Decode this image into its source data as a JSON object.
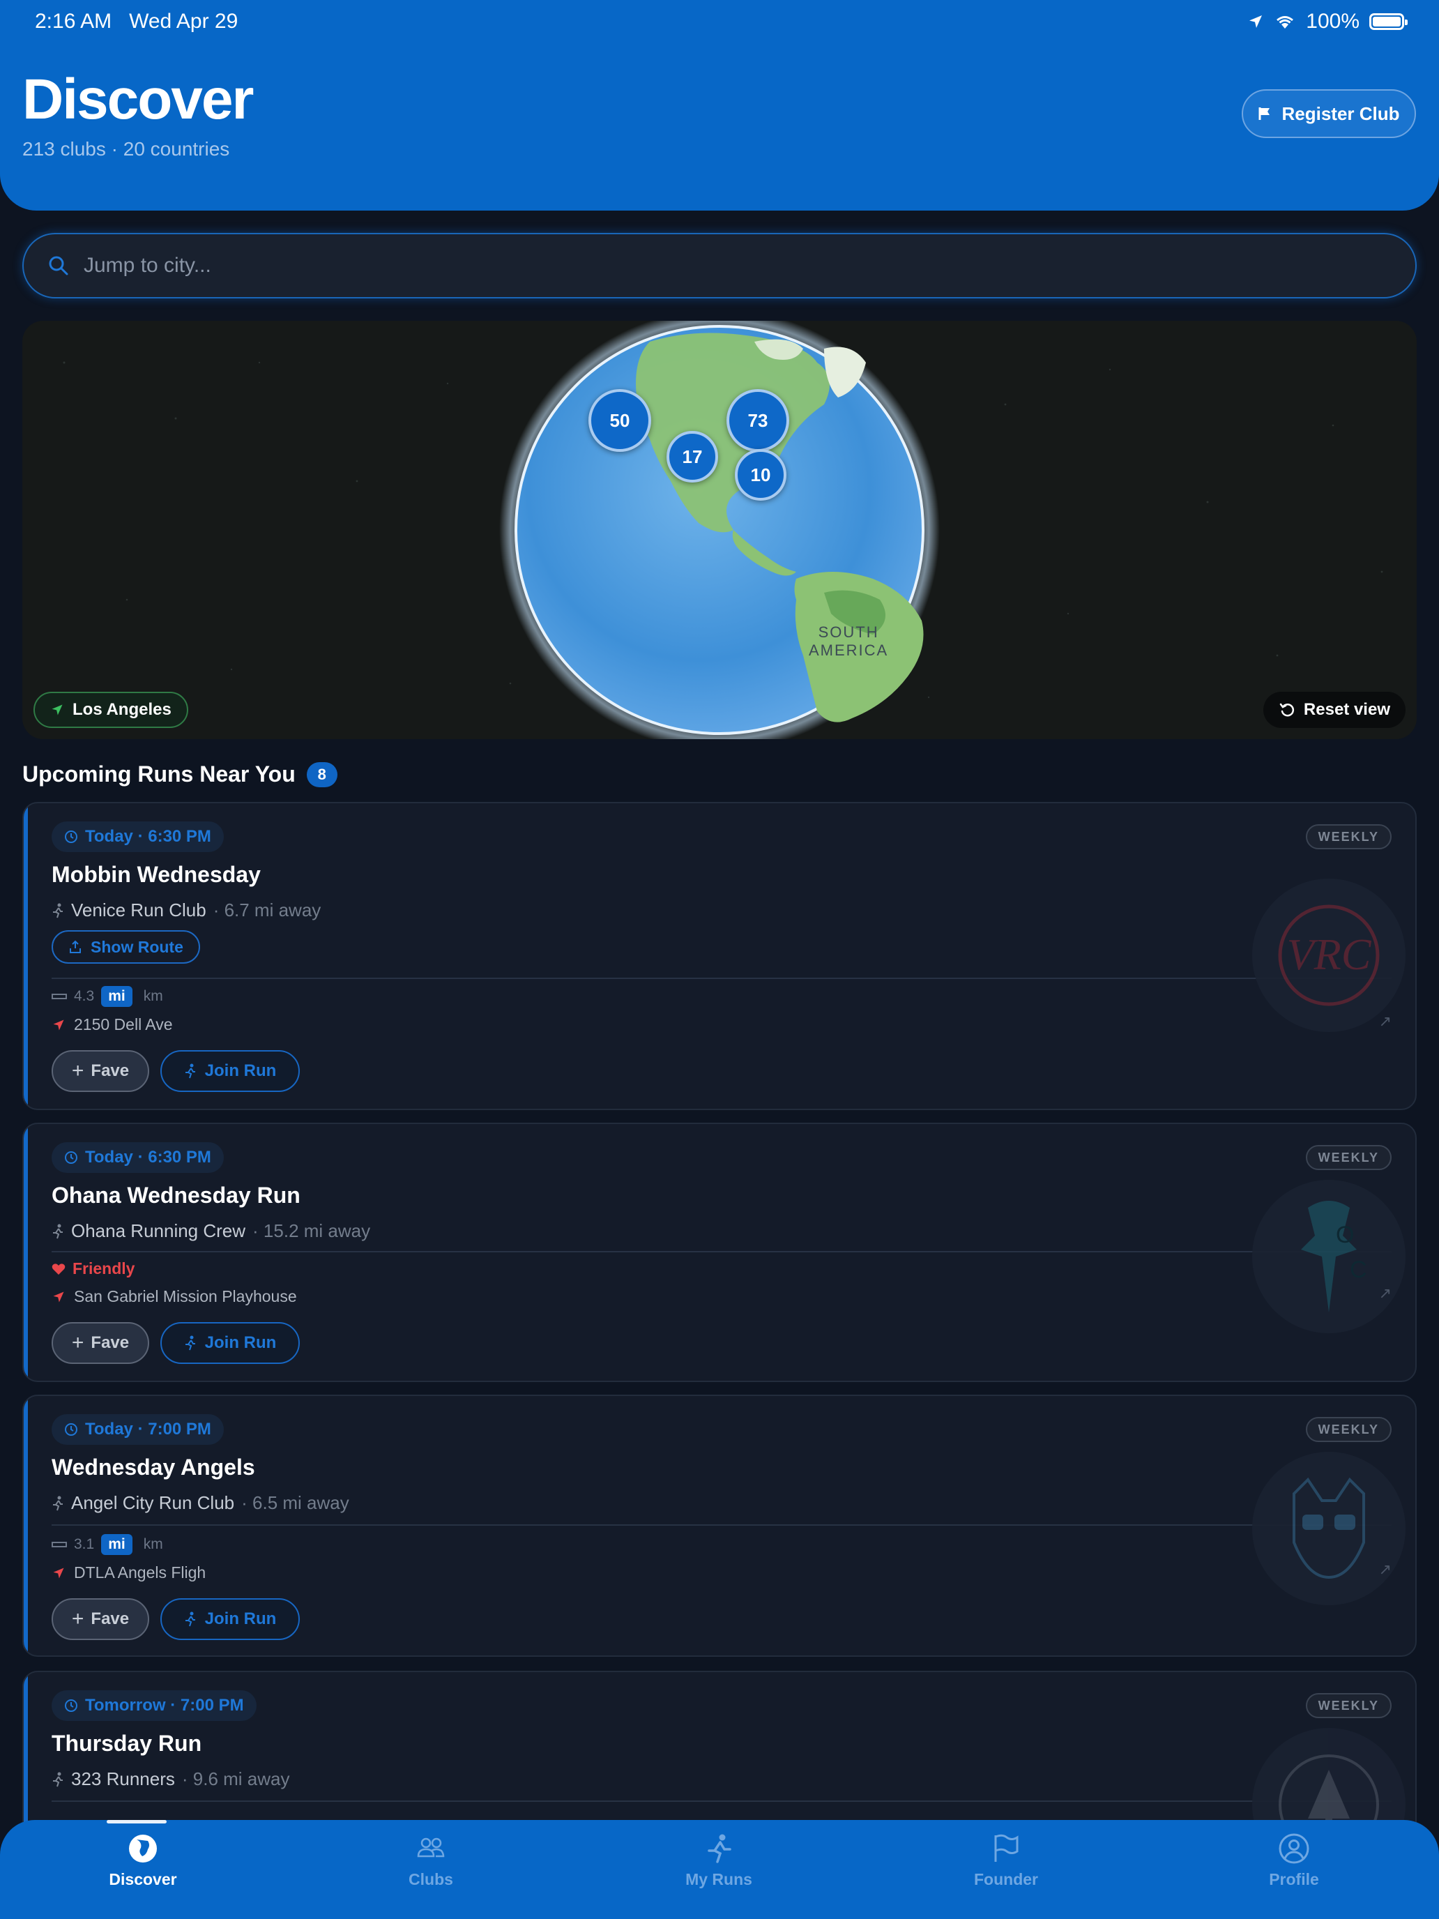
{
  "status_bar": {
    "time": "2:16 AM",
    "date": "Wed Apr 29",
    "battery": "100%"
  },
  "header": {
    "title": "Discover",
    "subtitle": "213 clubs · 20 countries",
    "register_label": "Register Club"
  },
  "search": {
    "placeholder": "Jump to city..."
  },
  "map": {
    "clusters": [
      "50",
      "73",
      "17",
      "10"
    ],
    "region_label_line1": "SOUTH",
    "region_label_line2": "AMERICA",
    "location_label": "Los Angeles",
    "reset_label": "Reset view"
  },
  "section": {
    "title": "Upcoming Runs Near You",
    "count": "8"
  },
  "runs": [
    {
      "time": "Today · 6:30 PM",
      "frequency": "WEEKLY",
      "title": "Mobbin Wednesday",
      "club": "Venice Run Club",
      "distance_away": "· 6.7 mi away",
      "route_label": "Show Route",
      "length": "4.3",
      "unit_mi": "mi",
      "unit_km": "km",
      "address": "2150 Dell Ave",
      "fave_label": "Fave",
      "join_label": "Join Run"
    },
    {
      "time": "Today · 6:30 PM",
      "frequency": "WEEKLY",
      "title": "Ohana Wednesday Run",
      "club": "Ohana Running Crew",
      "distance_away": "· 15.2 mi away",
      "tag": "Friendly",
      "address": "San Gabriel Mission Playhouse",
      "fave_label": "Fave",
      "join_label": "Join Run"
    },
    {
      "time": "Today · 7:00 PM",
      "frequency": "WEEKLY",
      "title": "Wednesday Angels",
      "club": "Angel City Run Club",
      "distance_away": "· 6.5 mi away",
      "length": "3.1",
      "unit_mi": "mi",
      "unit_km": "km",
      "address": "DTLA Angels Fligh",
      "fave_label": "Fave",
      "join_label": "Join Run"
    },
    {
      "time": "Tomorrow · 7:00 PM",
      "frequency": "WEEKLY",
      "title": "Thursday Run",
      "club": "323 Runners",
      "distance_away": "· 9.6 mi away"
    }
  ],
  "tabs": [
    {
      "label": "Discover",
      "icon": "globe-icon",
      "active": true
    },
    {
      "label": "Clubs",
      "icon": "people-icon"
    },
    {
      "label": "My Runs",
      "icon": "runner-icon"
    },
    {
      "label": "Founder",
      "icon": "flag-icon"
    },
    {
      "label": "Profile",
      "icon": "person-circle-icon"
    }
  ],
  "colors": {
    "primary": "#0767c7",
    "background": "#0d1421",
    "card": "#141b29",
    "accent_text": "#1f78d8",
    "friendly_red": "#e9474b"
  }
}
